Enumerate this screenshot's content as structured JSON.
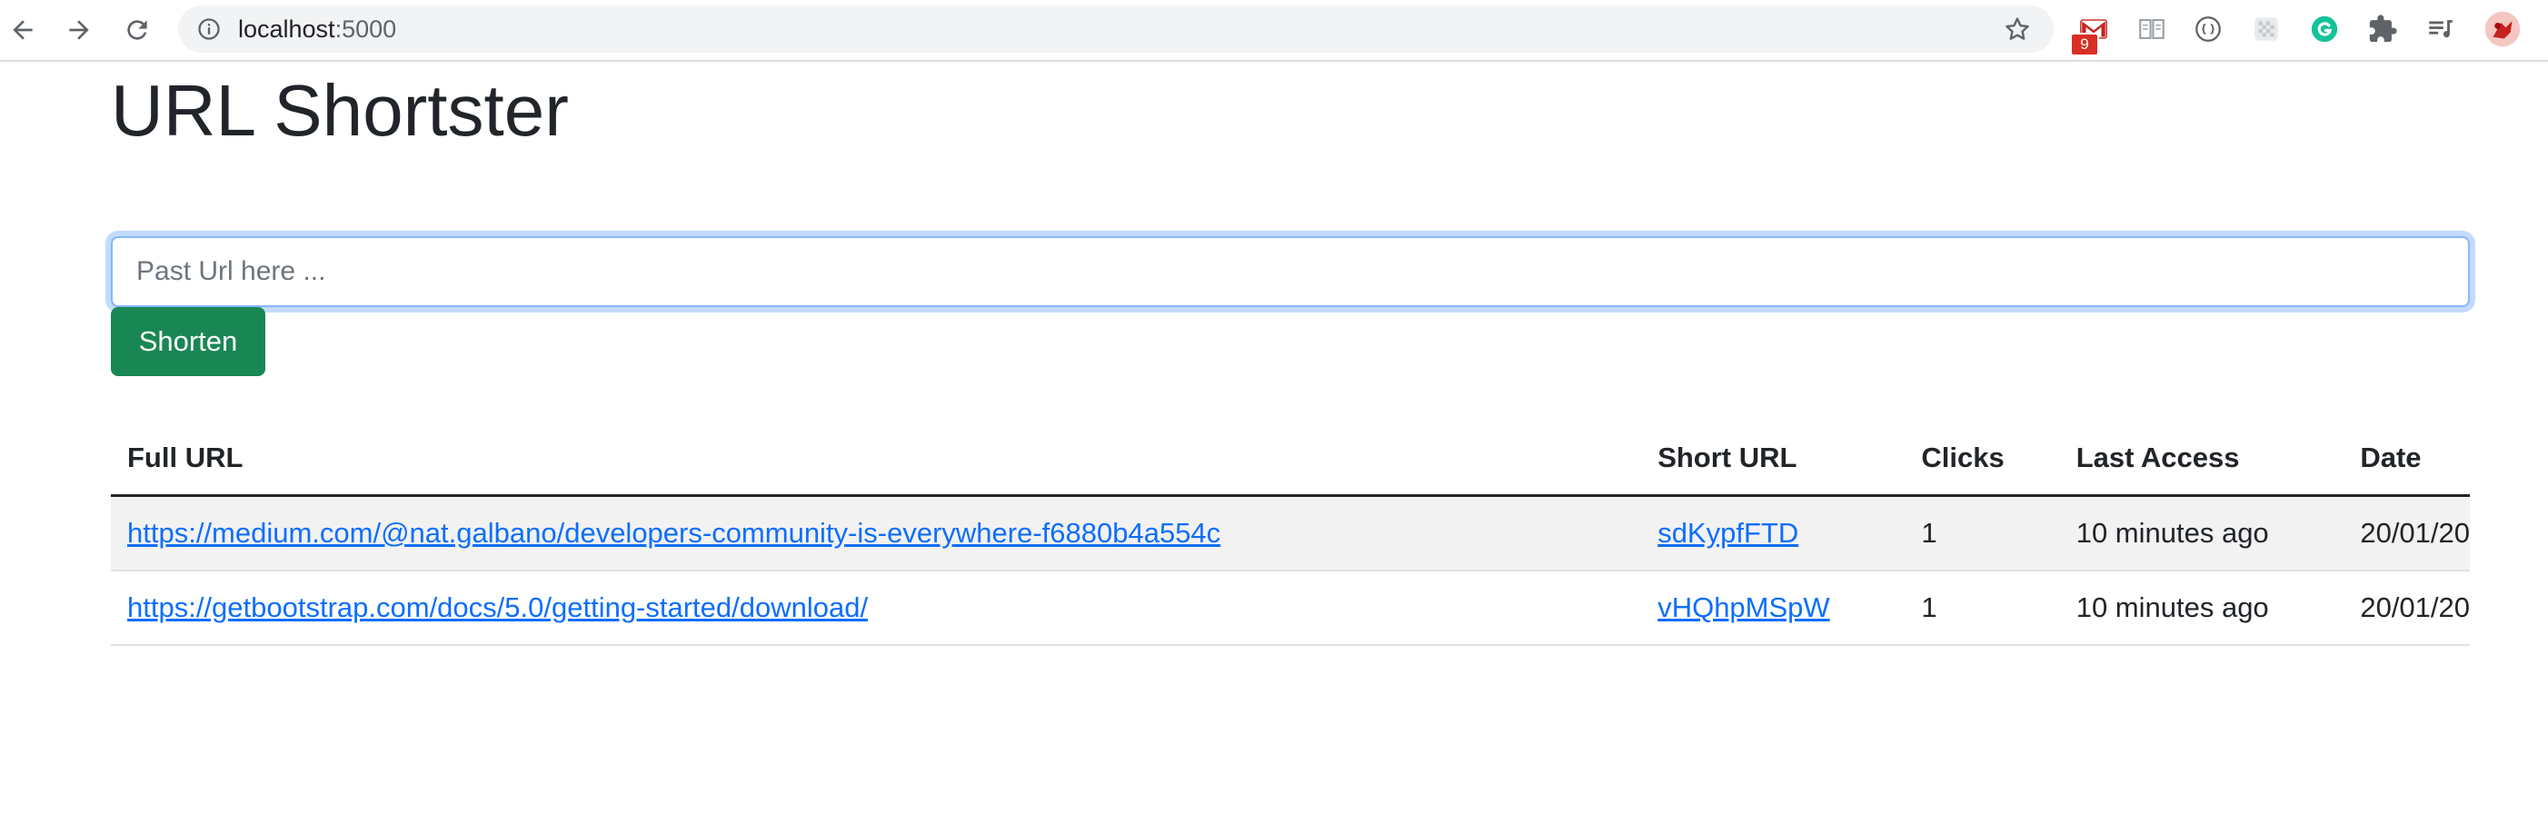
{
  "browser": {
    "address": {
      "host": "localhost",
      "port": ":5000"
    },
    "extensions": {
      "gmail_badge": "9"
    }
  },
  "page": {
    "title": "URL Shortster",
    "input_placeholder": "Past Url here ...",
    "button_label": "Shorten",
    "table": {
      "headers": {
        "full_url": "Full URL",
        "short_url": "Short URL",
        "clicks": "Clicks",
        "last_access": "Last Access",
        "date": "Date"
      },
      "rows": [
        {
          "full_url": "https://medium.com/@nat.galbano/developers-community-is-everywhere-f6880b4a554c",
          "short_url": "sdKypfFTD",
          "clicks": "1",
          "last_access": "10 minutes ago",
          "date": "20/01/20"
        },
        {
          "full_url": "https://getbootstrap.com/docs/5.0/getting-started/download/",
          "short_url": "vHQhpMSpW",
          "clicks": "1",
          "last_access": "10 minutes ago",
          "date": "20/01/20"
        }
      ]
    }
  },
  "colors": {
    "button": "#198754",
    "link": "#0d6efd",
    "input_focus_border": "#86b7fe"
  }
}
